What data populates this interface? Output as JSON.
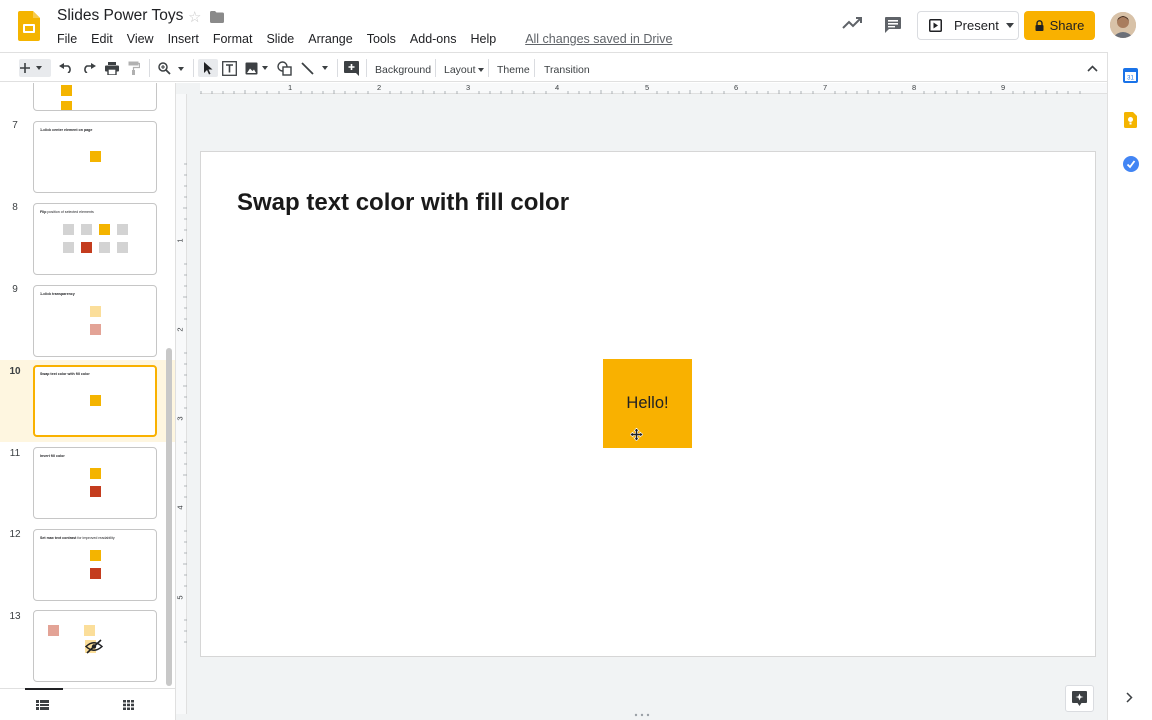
{
  "header": {
    "doc_title": "Slides Power Toys",
    "menu": [
      "File",
      "Edit",
      "View",
      "Insert",
      "Format",
      "Slide",
      "Arrange",
      "Tools",
      "Add-ons",
      "Help"
    ],
    "saved_status": "All changes saved in Drive",
    "present_label": "Present",
    "share_label": "Share"
  },
  "toolbar": {
    "background_label": "Background",
    "layout_label": "Layout",
    "theme_label": "Theme",
    "transition_label": "Transition"
  },
  "filmstrip": {
    "slides": [
      {
        "number": "7",
        "title": "1-click center element on page",
        "title_rest": ""
      },
      {
        "number": "8",
        "title": "Flip",
        "title_rest": " position of selected elements"
      },
      {
        "number": "9",
        "title": "1-click transparency",
        "title_rest": ""
      },
      {
        "number": "10",
        "title": "Swap text color with fill color",
        "title_rest": ""
      },
      {
        "number": "11",
        "title": "Invert fill color",
        "title_rest": ""
      },
      {
        "number": "12",
        "title": "Set max text contrast",
        "title_rest": " for improved readability"
      },
      {
        "number": "13",
        "title": "",
        "title_rest": ""
      }
    ],
    "selected": "10"
  },
  "rulers": {
    "horizontal": [
      "1",
      "2",
      "3",
      "4",
      "5",
      "6",
      "7",
      "8",
      "9"
    ],
    "vertical": [
      "1",
      "2",
      "3",
      "4",
      "5"
    ]
  },
  "slide": {
    "title": "Swap text color with fill color",
    "shape_text": "Hello!",
    "shape_color": "#f9b100"
  },
  "colors": {
    "accent": "#f9b100",
    "red": "#c43c1e"
  }
}
